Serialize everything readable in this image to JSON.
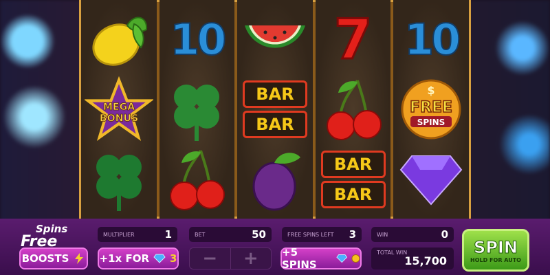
{
  "reels": [
    [
      "lemon",
      "mega-bonus",
      "clover"
    ],
    [
      "ten",
      "clover",
      "cherries"
    ],
    [
      "watermelon",
      "bar-bar",
      "plum"
    ],
    [
      "seven",
      "cherries",
      "bar-bar"
    ],
    [
      "ten",
      "free-spins",
      "diamond"
    ]
  ],
  "symbols": {
    "ten_label": "10",
    "seven_label": "7",
    "bar_label": "BAR",
    "mega_line1": "MEGA",
    "mega_line2": "BONUS",
    "free_spins_line1": "FREE",
    "free_spins_line2": "SPINS",
    "free_spins_dollar": "$"
  },
  "logo": {
    "line1": "Spins",
    "line2": "Free"
  },
  "hud": {
    "multiplier_label": "MULTIPLIER",
    "multiplier_value": "1",
    "bet_label": "BET",
    "bet_value": "50",
    "free_spins_left_label": "FREE SPINS LEFT",
    "free_spins_left_value": "3",
    "win_label": "WIN",
    "win_value": "0",
    "total_win_label": "TOTAL WIN",
    "total_win_value": "15,700"
  },
  "buttons": {
    "boosts": "BOOSTS",
    "plus1x": "+1x FOR",
    "plus1x_cost": "3",
    "minus": "−",
    "plus": "+",
    "plus5spins": "+5 SPINS",
    "spin": "SPIN",
    "spin_sub": "HOLD FOR AUTO"
  },
  "colors": {
    "accent": "#d440c8",
    "spin": "#5cbf22",
    "frame": "#d8a040"
  }
}
